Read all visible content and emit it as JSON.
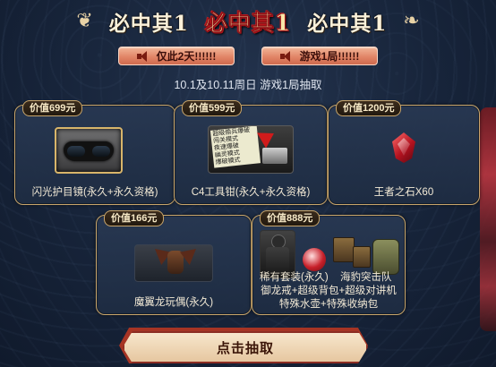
{
  "header": {
    "title_left": "必中其1",
    "title_center": "必中其1",
    "title_right": "必中其1"
  },
  "pills": [
    {
      "label": "仅此2天!!!!!!"
    },
    {
      "label": "游戏1局!!!!!!"
    }
  ],
  "subtitle": "10.1及10.11周日 游戏1局抽取",
  "items": [
    {
      "price": "价值699元",
      "name": "闪光护目镜(永久+永久资格)"
    },
    {
      "price": "价值599元",
      "name": "C4工具钳(永久+永久资格)"
    },
    {
      "price": "价值1200元",
      "name": "王者之石X60"
    },
    {
      "price": "价值166元",
      "name": "魔翼龙玩偶(永久)"
    },
    {
      "price": "价值888元",
      "name_line1_left": "稀有套装(永久)",
      "name_line1_right": "海豹突击队",
      "name_line2": "御龙戒+超级背包+超级对讲机",
      "name_line3": "特殊水壶+特殊收纳包"
    }
  ],
  "c4_notes": [
    "超级偷兵爆破",
    "闯关模式",
    "疾速爆破",
    "幽灵模式",
    "爆破模式"
  ],
  "draw_button": "点击抽取",
  "colors": {
    "accent_gold": "#c9a66b",
    "title_red": "#c2161c",
    "pill": "#e08264",
    "background": "#17243a"
  }
}
